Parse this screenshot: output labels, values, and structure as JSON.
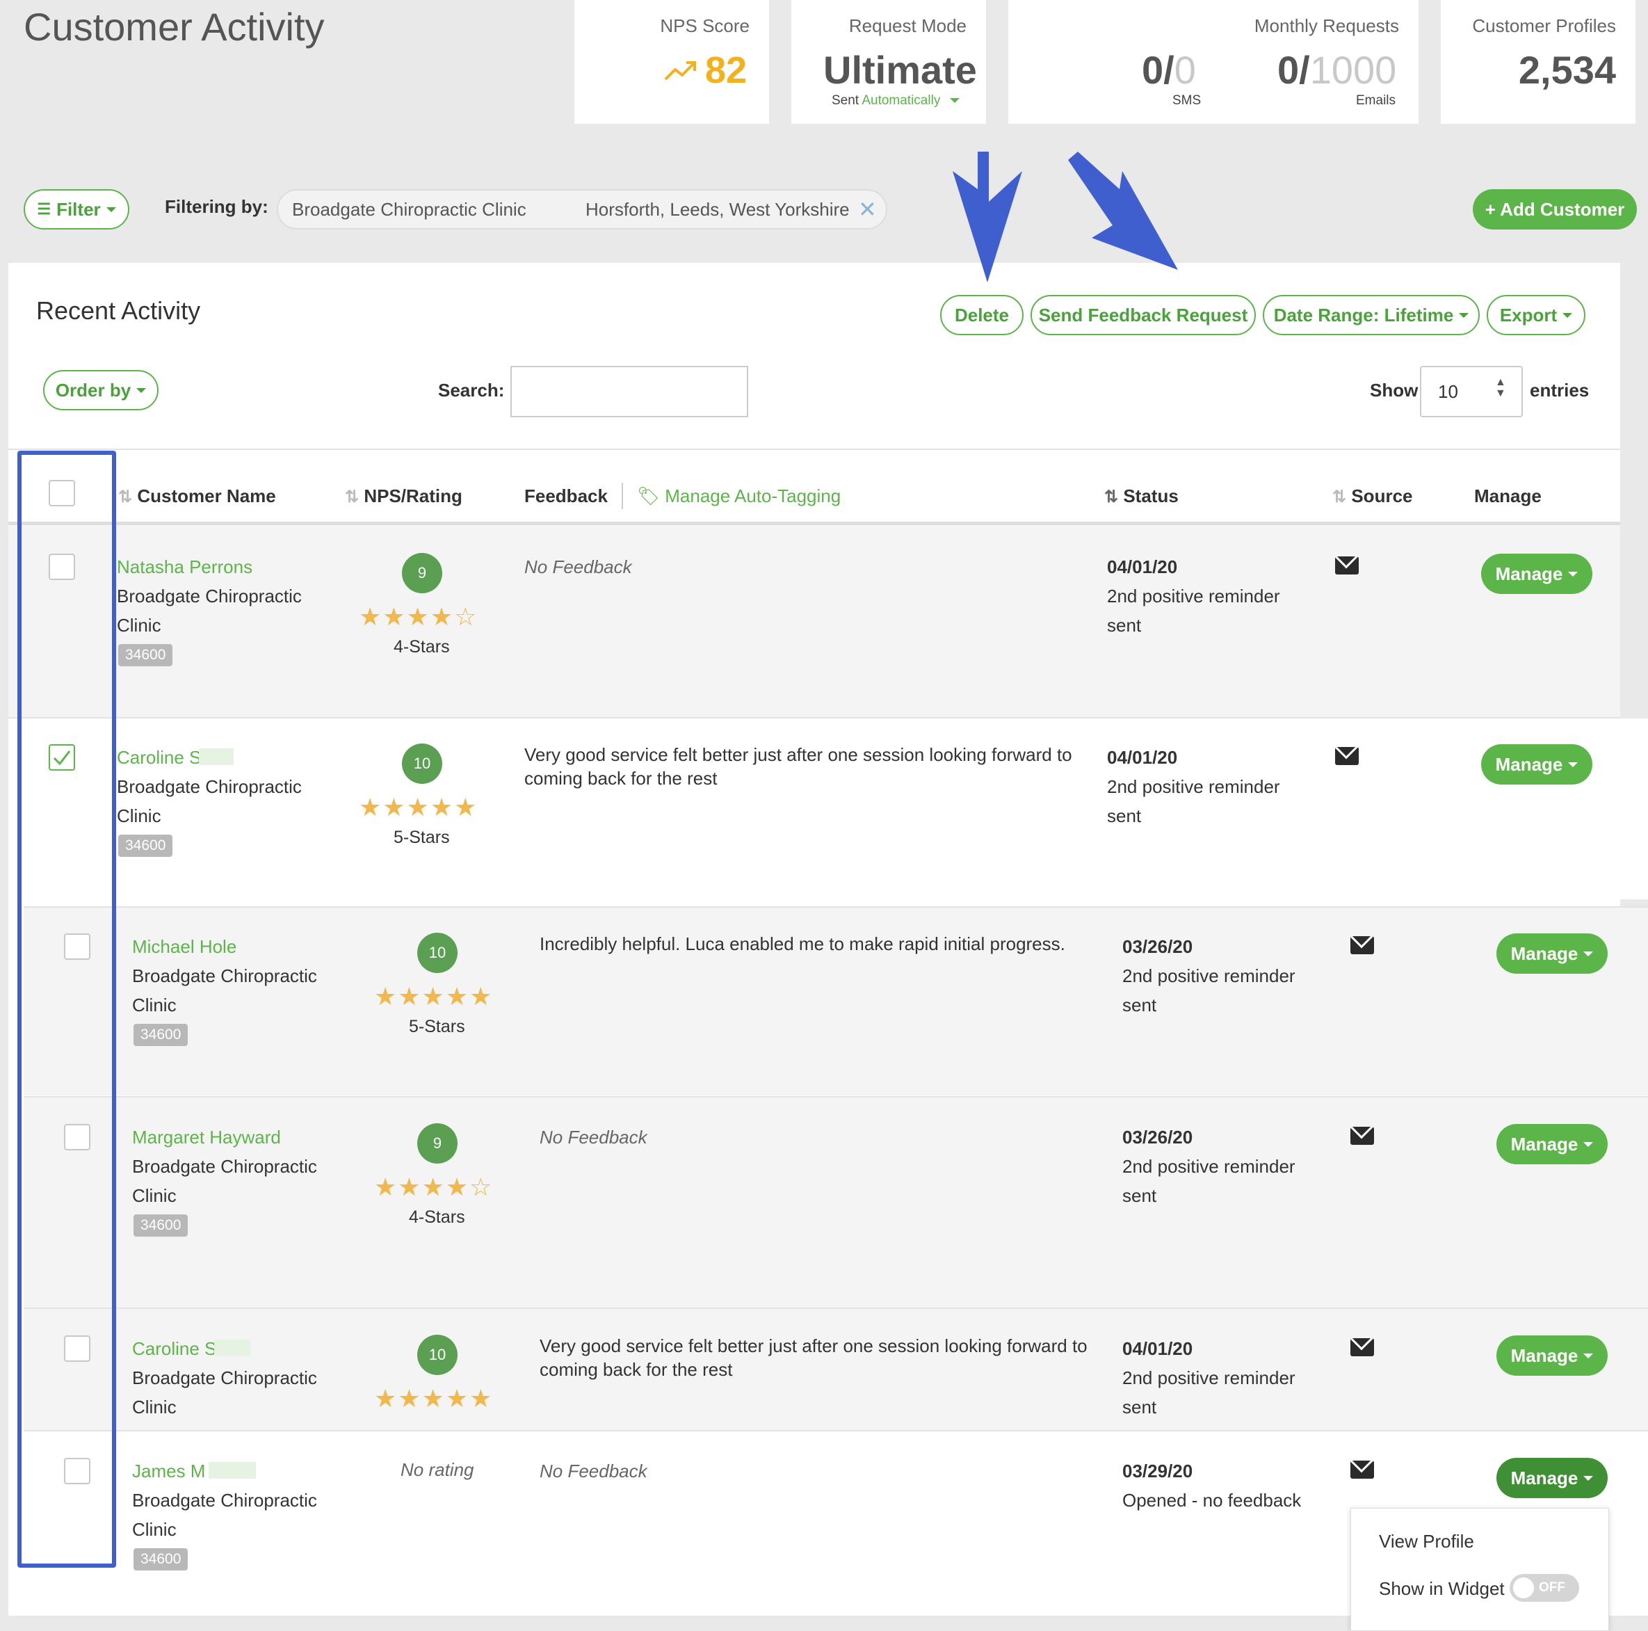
{
  "page_title": "Customer Activity",
  "stats": {
    "nps": {
      "label": "NPS Score",
      "value": "82"
    },
    "request_mode": {
      "label": "Request Mode",
      "value": "Ultimate",
      "sent_prefix": "Sent",
      "sent_mode": "Automatically"
    },
    "monthly": {
      "label": "Monthly Requests",
      "sms_used": "0/",
      "sms_total": "0",
      "sms_label": "SMS",
      "email_used": "0/",
      "email_total": "1000",
      "email_label": "Emails"
    },
    "profiles": {
      "label": "Customer Profiles",
      "value": "2,534"
    }
  },
  "filter": {
    "button_label": "Filter",
    "filtering_by": "Filtering by:",
    "clinic": "Broadgate Chiropractic Clinic",
    "location": "Horsforth, Leeds, West Yorkshire"
  },
  "add_customer": "+ Add Customer",
  "activity": {
    "title": "Recent Activity",
    "delete": "Delete",
    "send_feedback": "Send Feedback Request",
    "date_range": "Date Range: Lifetime",
    "export": "Export",
    "order_by": "Order by",
    "search_label": "Search:",
    "search_value": "",
    "show_label": "Show",
    "show_value": "10",
    "entries_label": "entries"
  },
  "columns": {
    "name": "Customer Name",
    "nps": "NPS/Rating",
    "feedback": "Feedback",
    "auto_tagging": "Manage Auto-Tagging",
    "status": "Status",
    "source": "Source",
    "manage": "Manage"
  },
  "rows": [
    {
      "name": "Natasha Perrons",
      "clinic": "Broadgate Chiropractic Clinic",
      "id": "34600",
      "nps": "9",
      "stars": "★★★★☆",
      "stars_label": "4-Stars",
      "feedback": "No Feedback",
      "date": "04/01/20",
      "status": "2nd positive reminder sent",
      "manage": "Manage",
      "checked": false
    },
    {
      "name": "Caroline S",
      "clinic": "Broadgate Chiropractic Clinic",
      "id": "34600",
      "nps": "10",
      "stars": "★★★★★",
      "stars_label": "5-Stars",
      "feedback": "Very good service felt better just after one session looking forward to coming back for the rest",
      "date": "04/01/20",
      "status": "2nd positive reminder sent",
      "manage": "Manage",
      "checked": true
    },
    {
      "name": "Michael Hole",
      "clinic": "Broadgate Chiropractic Clinic",
      "id": "34600",
      "nps": "10",
      "stars": "★★★★★",
      "stars_label": "5-Stars",
      "feedback": "Incredibly helpful. Luca enabled me to make rapid initial progress.",
      "date": "03/26/20",
      "status": "2nd positive reminder sent",
      "manage": "Manage",
      "checked": false
    },
    {
      "name": "Margaret Hayward",
      "clinic": "Broadgate Chiropractic Clinic",
      "id": "34600",
      "nps": "9",
      "stars": "★★★★☆",
      "stars_label": "4-Stars",
      "feedback": "No Feedback",
      "date": "03/26/20",
      "status": "2nd positive reminder sent",
      "manage": "Manage",
      "checked": false
    },
    {
      "name": "Caroline S",
      "clinic": "Broadgate Chiropractic Clinic",
      "nps": "10",
      "stars": "★★★★★",
      "feedback": "Very good service felt better just after one session looking forward to coming back for the rest",
      "date": "04/01/20",
      "status": "2nd positive reminder sent",
      "manage": "Manage",
      "checked": false
    },
    {
      "name": "James M",
      "clinic": "Broadgate Chiropractic Clinic",
      "id": "34600",
      "nps": "No rating",
      "feedback": "No Feedback",
      "date": "03/29/20",
      "status": "Opened - no feedback",
      "manage": "Manage",
      "checked": false
    }
  ],
  "manage_menu": {
    "view_profile": "View Profile",
    "show_in_widget": "Show in Widget",
    "toggle_state": "OFF"
  },
  "colors": {
    "accent": "#5cb548",
    "annotation": "#3f5fcf",
    "star": "#f0b84d",
    "nps_orange": "#f3b21d"
  }
}
